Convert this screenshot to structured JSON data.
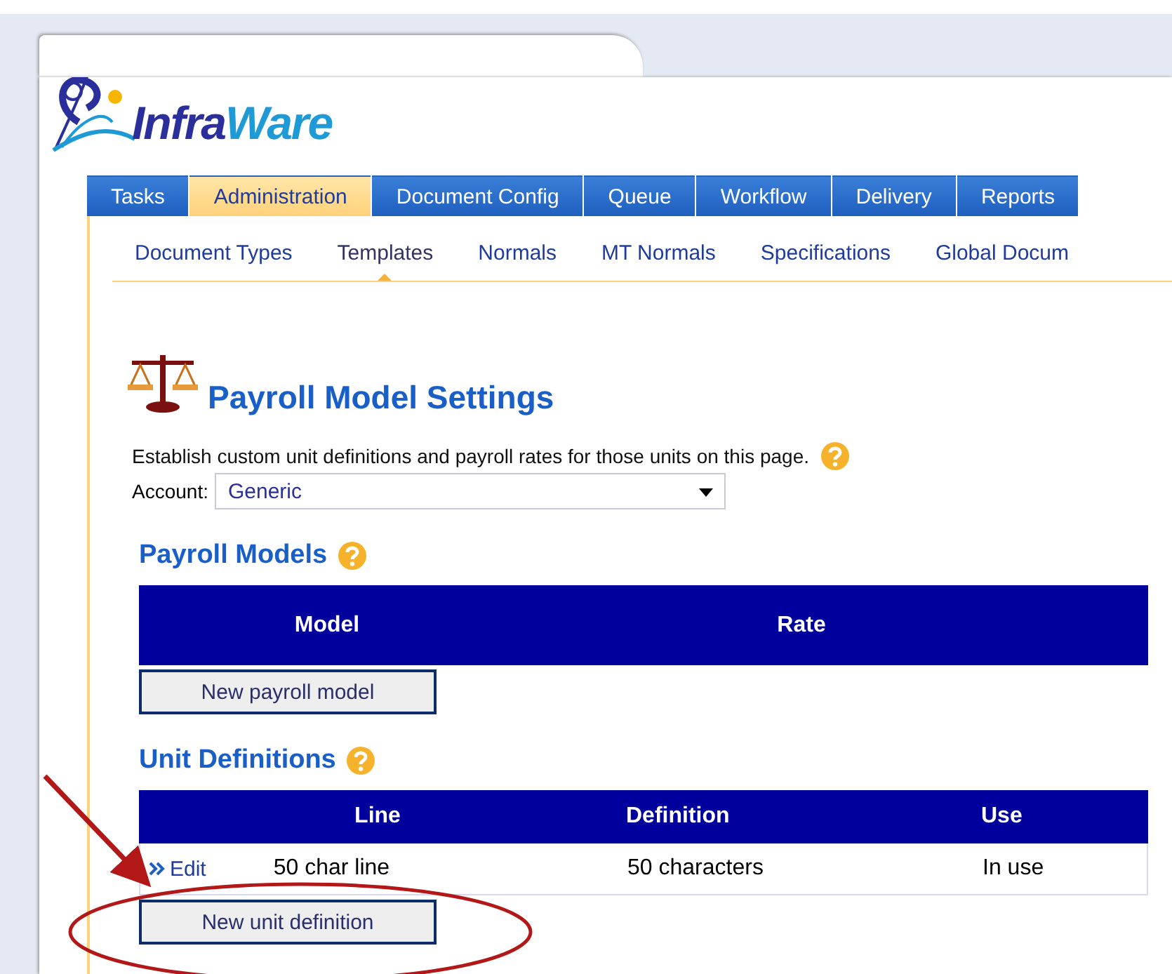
{
  "logo": {
    "text_a": "Infra",
    "text_b": "Ware"
  },
  "tabs": [
    {
      "label": "Tasks",
      "selected": false
    },
    {
      "label": "Administration",
      "selected": true
    },
    {
      "label": "Document Config",
      "selected": false
    },
    {
      "label": "Queue",
      "selected": false
    },
    {
      "label": "Workflow",
      "selected": false
    },
    {
      "label": "Delivery",
      "selected": false
    },
    {
      "label": "Reports",
      "selected": false
    }
  ],
  "subtabs": [
    {
      "label": "Document Types",
      "selected": false
    },
    {
      "label": "Templates",
      "selected": true
    },
    {
      "label": "Normals",
      "selected": false
    },
    {
      "label": "MT Normals",
      "selected": false
    },
    {
      "label": "Specifications",
      "selected": false
    },
    {
      "label": "Global Docum",
      "selected": false
    }
  ],
  "page": {
    "title": "Payroll Model Settings",
    "description": "Establish custom unit definitions and payroll rates for those units on this page.",
    "account_label": "Account:",
    "account_value": "Generic"
  },
  "payroll_models": {
    "heading": "Payroll Models",
    "columns": [
      "Model",
      "Rate"
    ],
    "button": "New payroll model"
  },
  "unit_definitions": {
    "heading": "Unit Definitions",
    "columns": [
      "Line",
      "Definition",
      "Use"
    ],
    "rows": [
      {
        "action": "Edit",
        "line": "50 char line",
        "definition": "50 characters",
        "use": "In use"
      }
    ],
    "button": "New unit definition"
  }
}
